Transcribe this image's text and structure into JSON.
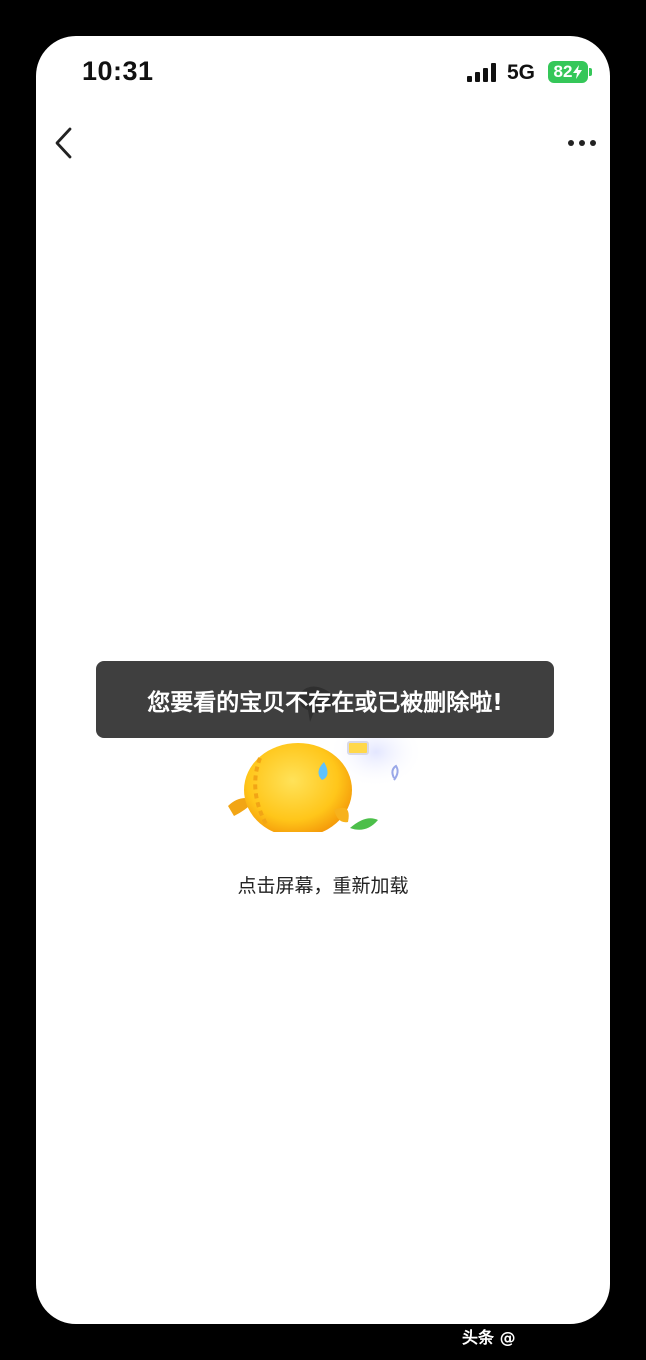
{
  "status_bar": {
    "time": "10:31",
    "network": "5G",
    "battery": "82"
  },
  "nav": {
    "back_icon": "chevron-left-icon",
    "more_icon": "more-horizontal-icon"
  },
  "error": {
    "illustration": "fish-mascot-sweating",
    "reload_text": "点击屏幕，重新加载"
  },
  "toast": {
    "message": "您要看的宝贝不存在或已被删除啦!"
  },
  "watermark": {
    "text": "头条 @"
  },
  "colors": {
    "battery": "#35c759",
    "toast_bg": "#303030",
    "fish": "#ffc61a"
  }
}
